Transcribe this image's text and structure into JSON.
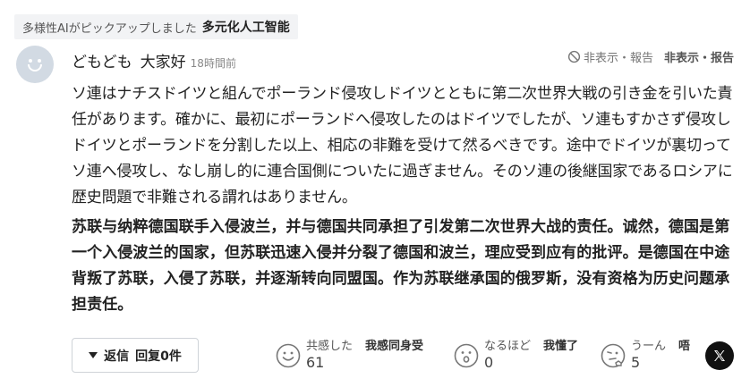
{
  "pick_badge": {
    "label_jp": "多様性AIがピックアップしました",
    "label_zh": "多元化人工智能"
  },
  "comment": {
    "author": "どもども",
    "author_zh": "大家好",
    "time": "18時間前",
    "report_jp": "非表示・報告",
    "report_zh": "非表示・报告",
    "body_jp": "ソ連はナチスドイツと組んでポーランド侵攻しドイツとともに第二次世界大戦の引き金を引いた責任があります。確かに、最初にポーランドへ侵攻したのはドイツでしたが、ソ連もすかさず侵攻しドイツとポーランドを分割した以上、相応の非難を受けて然るべきです。途中でドイツが裏切ってソ連へ侵攻し、なし崩し的に連合国側についたに過ぎません。そのソ連の後継国家であるロシアに歴史問題で非難される謂れはありません。",
    "body_zh": "苏联与纳粹德国联手入侵波兰，并与德国共同承担了引发第二次世界大战的责任。诚然，德国是第一个入侵波兰的国家，但苏联迅速入侵并分裂了德国和波兰，理应受到应有的批评。是德国在中途背叛了苏联，入侵了苏联，并逐渐转向同盟国。作为苏联继承国的俄罗斯，没有资格为历史问题承担责任。"
  },
  "actions": {
    "reply_label": "返信",
    "reply_count_label": "回复0件",
    "reactions": [
      {
        "icon": "smile-icon",
        "label": "共感した",
        "label_zh": "我感同身受",
        "count": "61"
      },
      {
        "icon": "surprised-icon",
        "label": "なるほど",
        "label_zh": "我懂了",
        "count": "0"
      },
      {
        "icon": "thinking-icon",
        "label": "うーん",
        "label_zh": "唔",
        "count": "5"
      }
    ],
    "share_icon": "x-logo-icon"
  }
}
